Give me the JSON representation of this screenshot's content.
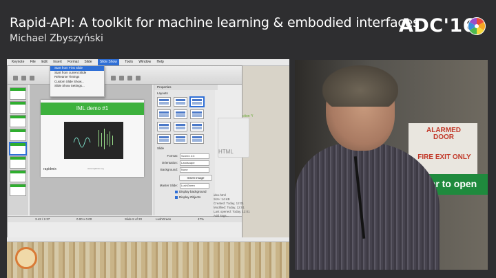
{
  "header": {
    "title": "Rapid-API: A toolkit for machine learning & embodied interfaces",
    "speaker": "Michael Zbyszyński",
    "logo": "ADC'16"
  },
  "mac_menubar": {
    "items": [
      "Keynote",
      "File",
      "Edit",
      "Insert",
      "Format",
      "Slide",
      "Slide Show",
      "Tools",
      "Window",
      "Help"
    ],
    "active": "Slide Show"
  },
  "slideshow_menu": {
    "items": [
      "Start from First Slide",
      "Start from current Slide",
      "Rehearse Timings",
      "Custom Slide Show...",
      "Slide Show Settings..."
    ]
  },
  "presentation": {
    "slide_title": "IML demo #1",
    "slide_logo": "rapidmix",
    "slide_footer": "www.rapidmix.org"
  },
  "sidebar": {
    "header": "Properties",
    "layouts_label": "Layouts",
    "slide_section_label": "Slide",
    "rows": [
      {
        "label": "Format:",
        "value": "Screen 4:3"
      },
      {
        "label": "Orientation:",
        "value": "Landscape"
      },
      {
        "label": "Background:",
        "value": "None"
      }
    ],
    "insert_image": "Insert Image",
    "master_slides_label": "Master Slide:",
    "master_slides_value": "LushGreen",
    "checkbox_bg": "Display background",
    "checkbox_objects": "Display Objects"
  },
  "statusbar": {
    "coords": "3.42 / 2.37",
    "size": "0.00 x 0.00",
    "slide": "Slide 8 of 20",
    "master": "LushGreen",
    "zoom": "47%"
  },
  "right_pane": {
    "code_snippet": "ction */",
    "file_label": "HTML",
    "file_name": "idex.html",
    "file_meta": [
      "Size: 14 KB",
      "Created: Today, 12:01",
      "Modified: Today, 12:01",
      "Last opened: Today, 12:01",
      "Add Tags..."
    ]
  },
  "photo": {
    "sign_line1": "ALARMED DOOR",
    "sign_line2": "FIRE EXIT ONLY",
    "sign_green": "bar to open"
  }
}
